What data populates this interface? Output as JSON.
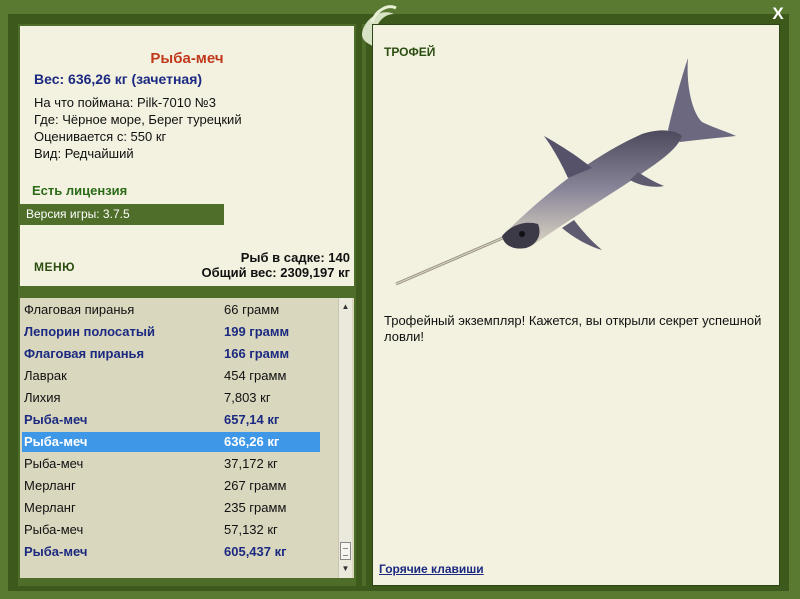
{
  "window": {
    "close_label": "X"
  },
  "catch": {
    "title": "Рыба-меч",
    "weight_line": "Вес: 636,26 кг (зачетная)",
    "details": [
      "На что поймана: Pilk-7010 №3",
      "Где: Чёрное море, Берег турецкий",
      "Оценивается с: 550 кг",
      "Вид: Редчайший"
    ],
    "license": "Есть лицензия",
    "version": "Версия игры: 3.7.5"
  },
  "menu": {
    "label": "МЕНЮ"
  },
  "cage": {
    "count": "Рыб в садке: 140",
    "total_weight": "Общий вес: 2309,197 кг"
  },
  "catch_list": [
    {
      "name": "Флаговая пиранья",
      "weight": "66 грамм",
      "state": "normal"
    },
    {
      "name": "Лепорин полосатый",
      "weight": "199 грамм",
      "state": "trophy"
    },
    {
      "name": "Флаговая пиранья",
      "weight": "166 грамм",
      "state": "trophy"
    },
    {
      "name": "Лаврак",
      "weight": "454 грамм",
      "state": "normal"
    },
    {
      "name": "Лихия",
      "weight": "7,803 кг",
      "state": "normal"
    },
    {
      "name": "Рыба-меч",
      "weight": "657,14 кг",
      "state": "trophy"
    },
    {
      "name": "Рыба-меч",
      "weight": "636,26 кг",
      "state": "selected"
    },
    {
      "name": "Рыба-меч",
      "weight": "37,172 кг",
      "state": "normal"
    },
    {
      "name": "Мерланг",
      "weight": "267 грамм",
      "state": "normal"
    },
    {
      "name": "Мерланг",
      "weight": "235 грамм",
      "state": "normal"
    },
    {
      "name": "Рыба-меч",
      "weight": "57,132 кг",
      "state": "normal"
    },
    {
      "name": "Рыба-меч",
      "weight": "605,437 кг",
      "state": "trophy"
    }
  ],
  "trophy": {
    "label": "ТРОФЕЙ",
    "text": "Трофейный экземпляр! Кажется, вы открыли секрет успешной ловли!",
    "hotkeys": "Горячие клавиши"
  },
  "colors": {
    "frame_green": "#5a7a32",
    "panel_cream": "#f3f2e1",
    "trophy_blue": "#1b2a80",
    "title_red": "#c0391b",
    "selection_blue": "#3f97e8"
  }
}
